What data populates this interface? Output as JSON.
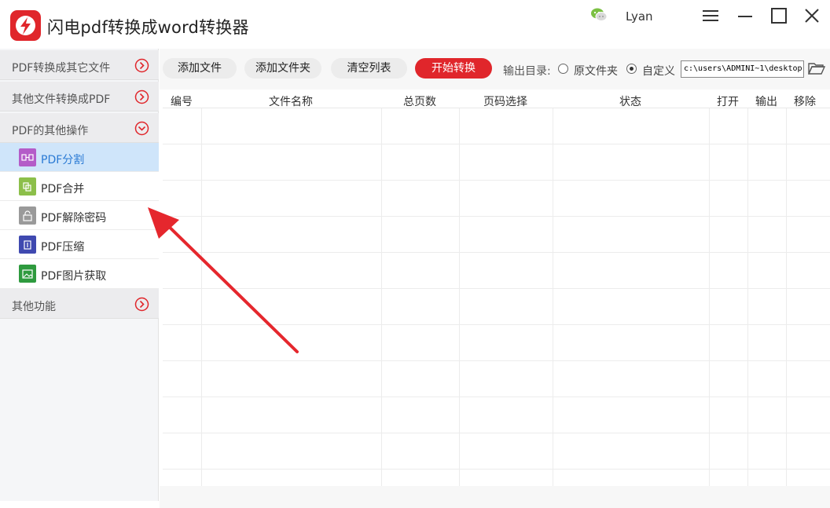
{
  "app": {
    "title": "闪电pdf转换成word转换器",
    "user": "Lyan"
  },
  "sidebar": {
    "sections": [
      {
        "label": "PDF转换成其它文件",
        "state": "collapsed"
      },
      {
        "label": "其他文件转换成PDF",
        "state": "collapsed"
      },
      {
        "label": "PDF的其他操作",
        "state": "expanded"
      },
      {
        "label": "其他功能",
        "state": "collapsed"
      }
    ],
    "items": [
      {
        "label": "PDF分割",
        "active": true,
        "icon_color": "#b45cc8"
      },
      {
        "label": "PDF合并",
        "active": false,
        "icon_color": "#8cbf4a"
      },
      {
        "label": "PDF解除密码",
        "active": false,
        "icon_color": "#9a9a9a"
      },
      {
        "label": "PDF压缩",
        "active": false,
        "icon_color": "#3f49b0"
      },
      {
        "label": "PDF图片获取",
        "active": false,
        "icon_color": "#2e9a3e"
      }
    ]
  },
  "toolbar": {
    "add_file": "添加文件",
    "add_folder": "添加文件夹",
    "clear_list": "清空列表",
    "start": "开始转换",
    "output_label": "输出目录:",
    "opt_original": "原文件夹",
    "opt_custom": "自定义",
    "selected_output": "自定义",
    "path": "c:\\users\\ADMINI~1\\desktop"
  },
  "table": {
    "columns": [
      "编号",
      "文件名称",
      "总页数",
      "页码选择",
      "状态",
      "打开",
      "输出",
      "移除"
    ],
    "rows": []
  },
  "colors": {
    "accent": "#e0262b",
    "active_bg": "#cfe5fa",
    "active_text": "#2a7ad4"
  }
}
